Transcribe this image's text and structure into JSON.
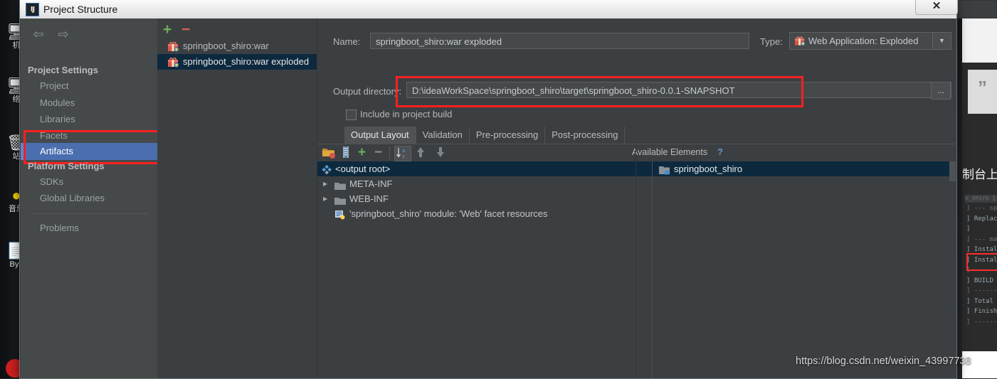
{
  "window": {
    "title": "Project Structure",
    "app_icon": "IJ",
    "close_label": "✕"
  },
  "sidebar": {
    "back_icon": "⇦",
    "forward_icon": "⇨",
    "groups": [
      {
        "label": "Project Settings",
        "items": [
          {
            "label": "Project",
            "selected": false
          },
          {
            "label": "Modules",
            "selected": false
          },
          {
            "label": "Libraries",
            "selected": false
          },
          {
            "label": "Facets",
            "selected": false
          },
          {
            "label": "Artifacts",
            "selected": true
          }
        ]
      },
      {
        "label": "Platform Settings",
        "items": [
          {
            "label": "SDKs",
            "selected": false
          },
          {
            "label": "Global Libraries",
            "selected": false
          }
        ]
      }
    ],
    "problems": "Problems",
    "highlight_color": "#ff2020",
    "selection_color": "#4b6eaf"
  },
  "artifacts": {
    "add_icon": "+",
    "remove_icon": "−",
    "items": [
      {
        "label": "springboot_shiro:war",
        "selected": false
      },
      {
        "label": "springboot_shiro:war exploded",
        "selected": true
      }
    ]
  },
  "main": {
    "name_label": "Name:",
    "name_value": "springboot_shiro:war exploded",
    "type_label": "Type:",
    "type_value": "Web Application: Exploded",
    "type_dropdown_icon": "▼",
    "output_dir_label": "Output directory:",
    "output_dir_value": "D:\\ideaWorkSpace\\springboot_shiro\\target\\springboot_shiro-0.0.1-SNAPSHOT",
    "browse_label": "...",
    "include_in_build_label": "Include in project build",
    "include_in_build_checked": false,
    "tabs": [
      {
        "label": "Output Layout",
        "active": true
      },
      {
        "label": "Validation",
        "active": false
      },
      {
        "label": "Pre-processing",
        "active": false
      },
      {
        "label": "Post-processing",
        "active": false
      }
    ],
    "toolbar": [
      {
        "name": "add-directory-content-icon",
        "glyph": ""
      },
      {
        "name": "add-archive-icon",
        "glyph": ""
      },
      {
        "name": "add-icon",
        "glyph": "+"
      },
      {
        "name": "remove-icon",
        "glyph": "−"
      },
      {
        "name": "sort-icon",
        "glyph": ""
      },
      {
        "name": "move-up-icon",
        "glyph": "↑"
      },
      {
        "name": "move-down-icon",
        "glyph": "↓"
      }
    ],
    "available_elements_label": "Available Elements",
    "help_icon": "?",
    "output_tree": [
      {
        "label": "<output root>",
        "indent": 0,
        "icon": "output-root-icon",
        "expander": "",
        "selected": true
      },
      {
        "label": "META-INF",
        "indent": 1,
        "icon": "folder-icon",
        "expander": "▶",
        "selected": false
      },
      {
        "label": "WEB-INF",
        "indent": 1,
        "icon": "folder-icon",
        "expander": "▶",
        "selected": false
      },
      {
        "label": "'springboot_shiro' module: 'Web' facet resources",
        "indent": 1,
        "icon": "module-facet-icon",
        "expander": "",
        "selected": false
      }
    ],
    "available_tree": [
      {
        "label": "springboot_shiro",
        "icon": "module-icon",
        "selected": true
      }
    ],
    "highlight_color": "#ff2020"
  },
  "background": {
    "desktop_icons": [
      {
        "label": "机",
        "glyph": "🖥"
      },
      {
        "label": "络",
        "glyph": "🌐"
      },
      {
        "label": "站",
        "glyph": "🗑"
      },
      {
        "label": "音乐",
        "glyph": "●"
      },
      {
        "label": "Byp",
        "glyph": "📄"
      }
    ],
    "cn_note": "制台上",
    "quote_glyph": "”",
    "console_lines": [
      "] --- spr",
      "] Replacin",
      "]",
      "] --- mav",
      "] Install",
      "] Install",
      "] --------",
      "] BUILD SU",
      "] --------",
      "] Total ti",
      "] Finished",
      "] --------"
    ],
    "console_header": "o_shiro [install"
  },
  "watermark": "https://blog.csdn.net/weixin_43997738"
}
